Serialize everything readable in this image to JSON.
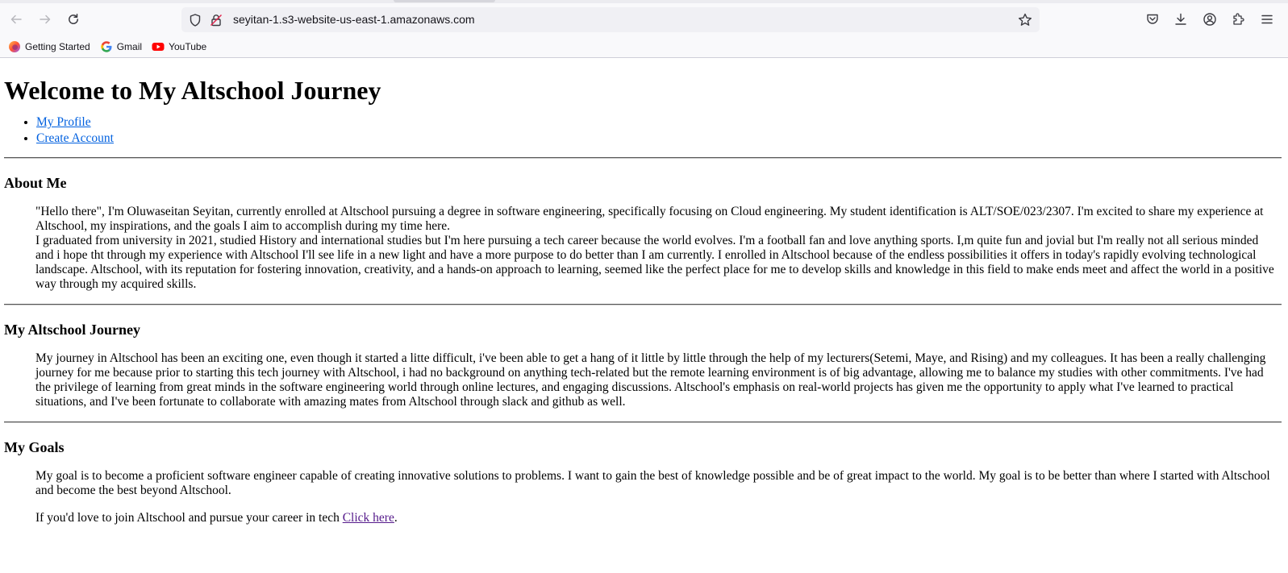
{
  "browser": {
    "url": "seyitan-1.s3-website-us-east-1.amazonaws.com",
    "bookmarks": [
      {
        "label": "Getting Started",
        "icon": "firefox-icon"
      },
      {
        "label": "Gmail",
        "icon": "google-icon"
      },
      {
        "label": "YouTube",
        "icon": "youtube-icon"
      }
    ]
  },
  "page": {
    "title": "Welcome to My Altschool Journey",
    "nav": [
      {
        "label": "My Profile"
      },
      {
        "label": "Create Account"
      }
    ],
    "about": {
      "heading": "About Me",
      "p1": "\"Hello there\", I'm Oluwaseitan Seyitan, currently enrolled at Altschool pursuing a degree in software engineering, specifically focusing on Cloud engineering. My student identification is ALT/SOE/023/2307. I'm excited to share my experience at Altschool, my inspirations, and the goals I aim to accomplish during my time here.",
      "p2": "I graduated from university in 2021, studied History and international studies but I'm here pursuing a tech career because the world evolves. I'm a football fan and love anything sports. I,m quite fun and jovial but I'm really not all serious minded and i hope tht through my experience with Altschool I'll see life in a new light and have a more purpose to do better than I am currently. I enrolled in Altschool because of the endless possibilities it offers in today's rapidly evolving technological landscape. Altschool, with its reputation for fostering innovation, creativity, and a hands-on approach to learning, seemed like the perfect place for me to develop skills and knowledge in this field to make ends meet and affect the world in a positive way through my acquired skills."
    },
    "journey": {
      "heading": "My Altschool Journey",
      "p1": "My journey in Altschool has been an exciting one, even though it started a litte difficult, i've been able to get a hang of it little by little through the help of my lecturers(Setemi, Maye, and Rising) and my colleagues. It has been a really challenging journey for me because prior to starting this tech journey with Altschool, i had no background on anything tech-related but the remote learning environment is of big advantage, allowing me to balance my studies with other commitments. I've had the privilege of learning from great minds in the software engineering world through online lectures, and engaging discussions. Altschool's emphasis on real-world projects has given me the opportunity to apply what I've learned to practical situations, and I've been fortunate to collaborate with amazing mates from Altschool through slack and github as well."
    },
    "goals": {
      "heading": "My Goals",
      "p1": "My goal is to become a proficient software engineer capable of creating innovative solutions to problems. I want to gain the best of knowledge possible and be of great impact to the world. My goal is to be better than where I started with Altschool and become the best beyond Altschool.",
      "p2_prefix": "If you'd love to join Altschool and pursue your career in tech ",
      "p2_link": "Click here",
      "p2_suffix": "."
    }
  },
  "colors": {
    "link": "#0060df",
    "visited_link": "#551a8b",
    "chrome_bg": "#f9f9fb",
    "urlbar_bg": "#f0f0f4"
  }
}
